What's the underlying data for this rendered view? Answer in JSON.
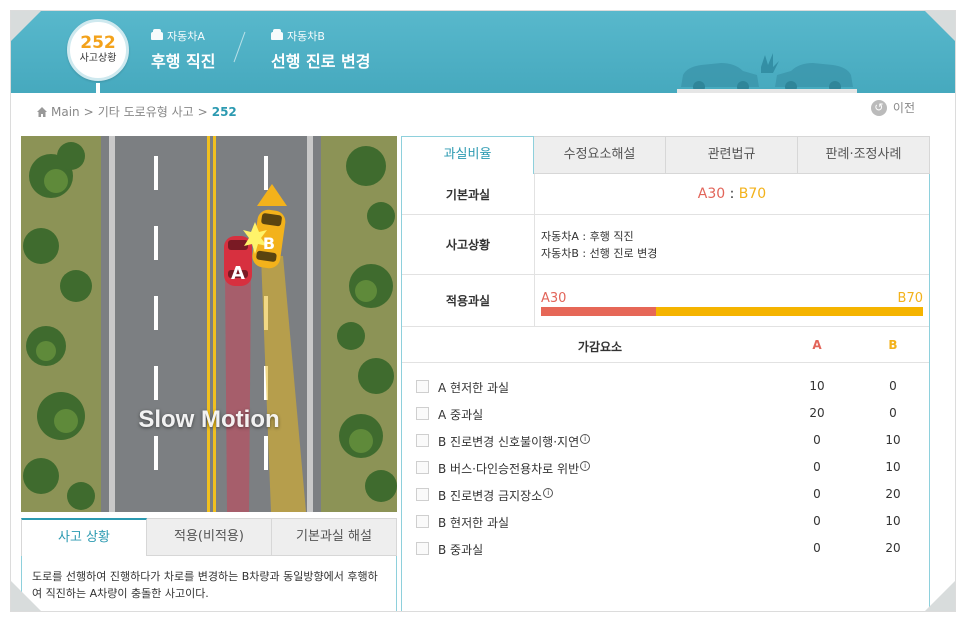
{
  "header": {
    "case_number": "252",
    "case_label": "사고상황",
    "car_a": {
      "label": "자동차A",
      "action": "후행 직진"
    },
    "car_b": {
      "label": "자동차B",
      "action": "선행 진로 변경"
    }
  },
  "breadcrumb": [
    "Main",
    "기타 도로유형 사고",
    "252"
  ],
  "prev_label": "이전",
  "scene": {
    "overlay_text": "Slow Motion",
    "car_a_marker": "A",
    "car_b_marker": "B"
  },
  "left_tabs": [
    "사고 상황",
    "적용(비적용)",
    "기본과실 해설"
  ],
  "description": "도로를 선행하여 진행하다가 차로를 변경하는 B차량과 동일방향에서 후행하여 직진하는 A차량이 충돌한 사고이다.",
  "right_tabs": [
    "과실비율",
    "수정요소해설",
    "관련법규",
    "판례·조정사례"
  ],
  "basic_fault": {
    "label": "기본과실",
    "a": "A30",
    "sep": " : ",
    "b": "B70"
  },
  "situation": {
    "label": "사고상황",
    "line_a": "자동차A : 후행 직진",
    "line_b": "자동차B : 선행 진로 변경"
  },
  "applied_fault": {
    "label": "적용과실",
    "a_label": "A30",
    "b_label": "B70",
    "a_percent": 30,
    "b_percent": 70
  },
  "factors": {
    "header": {
      "title": "가감요소",
      "a": "A",
      "b": "B"
    },
    "rows": [
      {
        "label": "A 현저한 과실",
        "a": "10",
        "b": "0",
        "info": false
      },
      {
        "label": "A 중과실",
        "a": "20",
        "b": "0",
        "info": false
      },
      {
        "label": "B 진로변경 신호불이행·지연",
        "a": "0",
        "b": "10",
        "info": true
      },
      {
        "label": "B 버스·다인승전용차로 위반",
        "a": "0",
        "b": "10",
        "info": true
      },
      {
        "label": "B 진로변경 금지장소",
        "a": "0",
        "b": "20",
        "info": true
      },
      {
        "label": "B 현저한 과실",
        "a": "0",
        "b": "10",
        "info": false
      },
      {
        "label": "B 중과실",
        "a": "0",
        "b": "20",
        "info": false
      }
    ]
  },
  "colors": {
    "accent": "#2c9ab1",
    "header_bg": "#4fb3c7",
    "car_a": "#e2655a",
    "car_b": "#f3b21b"
  }
}
